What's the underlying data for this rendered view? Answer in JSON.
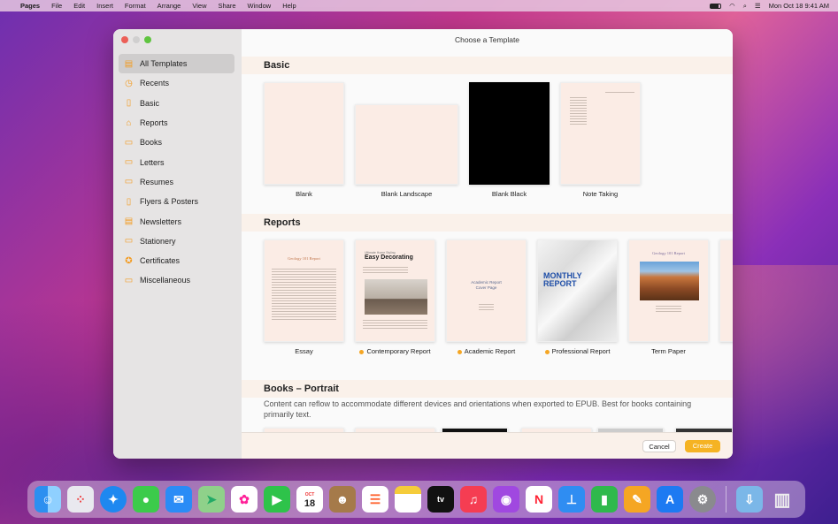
{
  "menubar": {
    "apple": "",
    "app": "Pages",
    "items": [
      "File",
      "Edit",
      "Insert",
      "Format",
      "Arrange",
      "View",
      "Share",
      "Window",
      "Help"
    ],
    "datetime": "Mon Oct 18  9:41 AM"
  },
  "window": {
    "title": "Choose a Template"
  },
  "sidebar": {
    "items": [
      {
        "label": "All Templates",
        "icon": "all-templates-icon",
        "glyph": "▤"
      },
      {
        "label": "Recents",
        "icon": "clock-icon",
        "glyph": "◷"
      },
      {
        "label": "Basic",
        "icon": "document-icon",
        "glyph": "▯"
      },
      {
        "label": "Reports",
        "icon": "reports-icon",
        "glyph": "⌂"
      },
      {
        "label": "Books",
        "icon": "book-icon",
        "glyph": "▭"
      },
      {
        "label": "Letters",
        "icon": "letter-icon",
        "glyph": "▭"
      },
      {
        "label": "Resumes",
        "icon": "resume-icon",
        "glyph": "▭"
      },
      {
        "label": "Flyers & Posters",
        "icon": "flyer-icon",
        "glyph": "▯"
      },
      {
        "label": "Newsletters",
        "icon": "newsletter-icon",
        "glyph": "▤"
      },
      {
        "label": "Stationery",
        "icon": "stationery-icon",
        "glyph": "▭"
      },
      {
        "label": "Certificates",
        "icon": "certificate-icon",
        "glyph": "✪"
      },
      {
        "label": "Miscellaneous",
        "icon": "box-icon",
        "glyph": "▭"
      }
    ]
  },
  "sections": {
    "basic": {
      "title": "Basic",
      "templates": [
        "Blank",
        "Blank Landscape",
        "Blank Black",
        "Note Taking"
      ]
    },
    "reports": {
      "title": "Reports",
      "templates": [
        {
          "label": "Essay",
          "new": false
        },
        {
          "label": "Contemporary Report",
          "new": true
        },
        {
          "label": "Academic Report",
          "new": true
        },
        {
          "label": "Professional Report",
          "new": true
        },
        {
          "label": "Term Paper",
          "new": false
        }
      ]
    },
    "books": {
      "title": "Books – Portrait",
      "description": "Content can reflow to accommodate different devices and orientations when exported to EPUB. Best for books containing primarily text."
    }
  },
  "thumb_text": {
    "essay_title": "Geology 101 Report",
    "contemporary_kicker": "Ultimate Home Styling",
    "contemporary_title": "Easy Decorating",
    "academic_title": "Academic Report Cover Page",
    "professional_title": "MONTHLY REPORT",
    "term_title": "Geology 101 Report"
  },
  "footer": {
    "cancel": "Cancel",
    "create": "Create"
  },
  "dock": {
    "calendar_month": "OCT",
    "calendar_day": "18",
    "tv_label": "tv",
    "apps": [
      "finder-icon",
      "launchpad-icon",
      "safari-icon",
      "messages-icon",
      "mail-icon",
      "maps-icon",
      "photos-icon",
      "facetime-icon",
      "calendar-icon",
      "contacts-icon",
      "reminders-icon",
      "notes-icon",
      "tv-icon",
      "music-icon",
      "podcasts-icon",
      "news-icon",
      "keynote-icon",
      "numbers-icon",
      "pages-icon",
      "app-store-icon",
      "system-preferences-icon",
      "downloads-icon",
      "trash-icon"
    ]
  },
  "colors": {
    "accent": "#f5a623",
    "create": "#f5b323"
  }
}
